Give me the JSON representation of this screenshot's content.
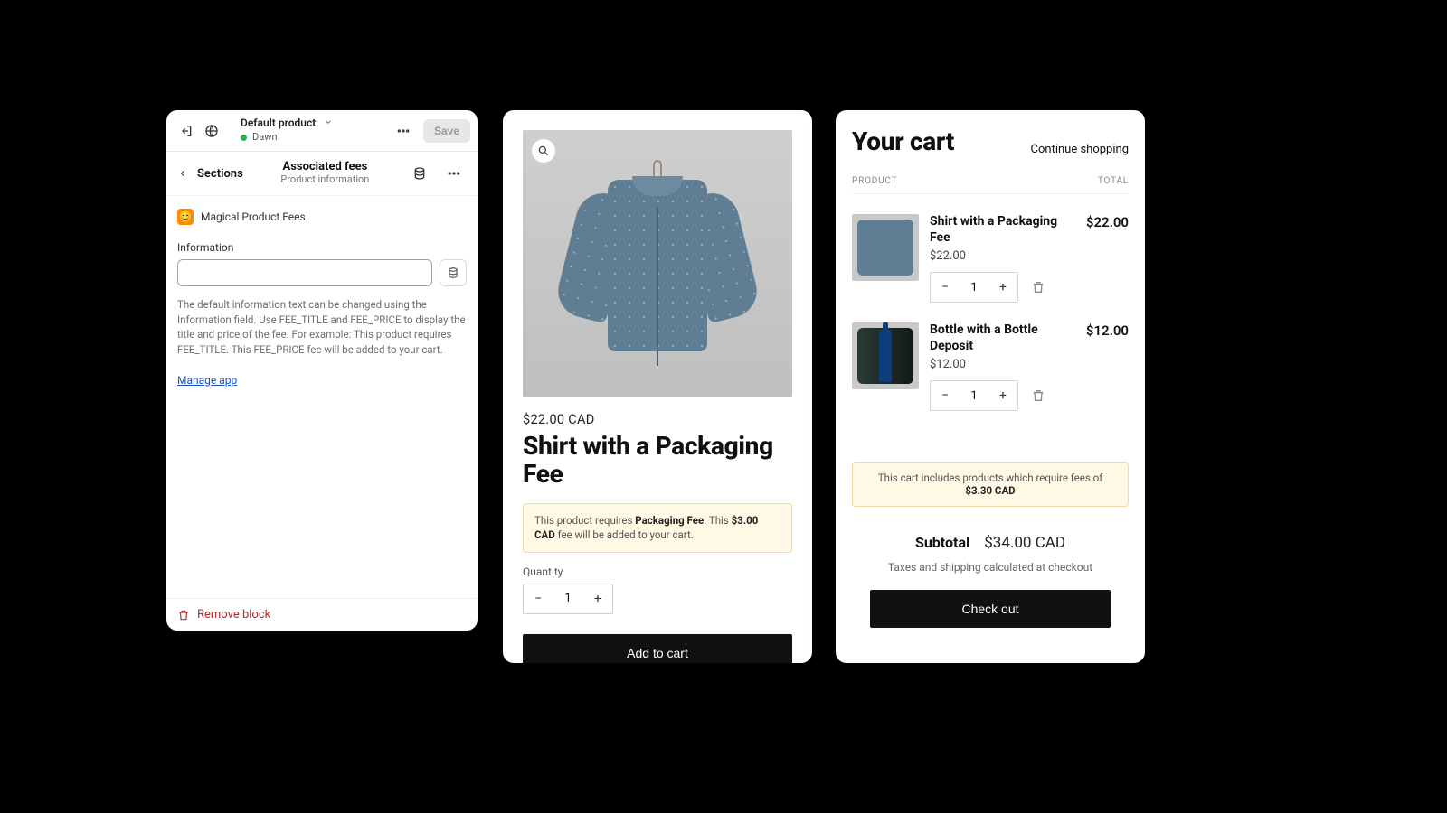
{
  "editor": {
    "top": {
      "product_select": "Default product",
      "theme": "Dawn",
      "save": "Save"
    },
    "breadcrumb": "Sections",
    "section_title": "Associated fees",
    "section_sub": "Product information",
    "app_name": "Magical Product Fees",
    "info_label": "Information",
    "help_text": "The default information text can be changed using the Information field. Use FEE_TITLE and FEE_PRICE to display the title and price of the fee. For example: This product requires FEE_TITLE. This FEE_PRICE fee will be added to your cart.",
    "manage_app": "Manage app",
    "remove_block": "Remove block"
  },
  "product": {
    "price": "$22.00 CAD",
    "title": "Shirt with a Packaging Fee",
    "notice_pre": "This product requires ",
    "notice_fee": "Packaging Fee",
    "notice_mid": ". This ",
    "notice_amt": "$3.00 CAD",
    "notice_post": " fee will be added to your cart.",
    "qty_label": "Quantity",
    "qty_value": "1",
    "add_to_cart": "Add to cart"
  },
  "cart": {
    "title": "Your cart",
    "continue": "Continue shopping",
    "col_product": "PRODUCT",
    "col_total": "TOTAL",
    "items": [
      {
        "name": "Shirt with a Packaging Fee",
        "unit": "$22.00",
        "qty": "1",
        "line": "$22.00"
      },
      {
        "name": "Bottle with a Bottle Deposit",
        "unit": "$12.00",
        "qty": "1",
        "line": "$12.00"
      }
    ],
    "notice_pre": "This cart includes products which require fees of ",
    "notice_amt": "$3.30 CAD",
    "subtotal_label": "Subtotal",
    "subtotal_value": "$34.00 CAD",
    "tax_note": "Taxes and shipping calculated at checkout",
    "checkout": "Check out"
  }
}
